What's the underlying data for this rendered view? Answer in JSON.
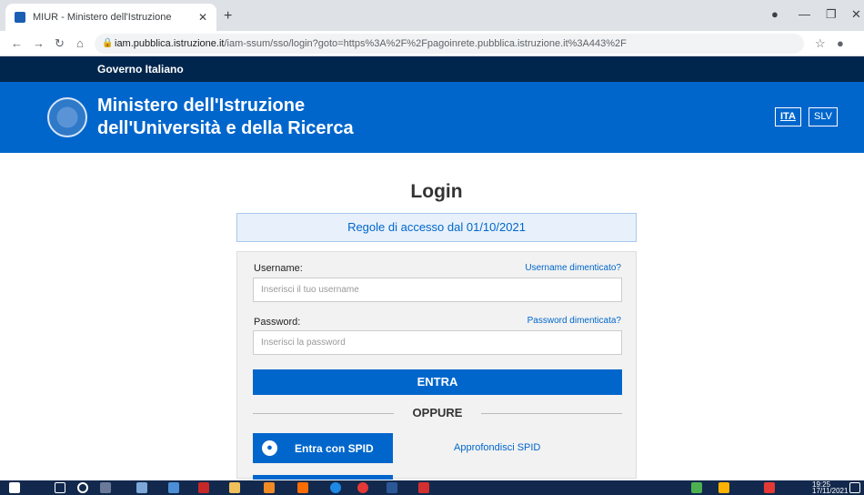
{
  "browser": {
    "tab_title": "MIUR - Ministero dell'Istruzione",
    "new_tab": "+",
    "url_host": "iam.pubblica.istruzione.it",
    "url_path": "/iam-ssum/sso/login?goto=https%3A%2F%2Fpagoinrete.pubblica.istruzione.it%3A443%2F"
  },
  "gov_bar": {
    "label": "Governo Italiano"
  },
  "header": {
    "title_line1": "Ministero dell'Istruzione",
    "title_line2": "dell'Università e della Ricerca",
    "lang_ita": "ITA",
    "lang_slv": "SLV"
  },
  "login": {
    "title": "Login",
    "notice": "Regole di accesso dal 01/10/2021",
    "username_label": "Username:",
    "username_forgot": "Username dimenticato?",
    "username_placeholder": "Inserisci il tuo username",
    "password_label": "Password:",
    "password_forgot": "Password dimenticata?",
    "password_placeholder": "Inserisci la password",
    "submit": "ENTRA",
    "or": "OPPURE",
    "spid_button": "Entra con SPID",
    "spid_info": "Approfondisci SPID"
  },
  "taskbar": {
    "time": "19:25",
    "date": "17/11/2021"
  },
  "colors": {
    "brand": "#0066cc",
    "gov_bar": "#00264d",
    "taskbar": "#12294d"
  }
}
